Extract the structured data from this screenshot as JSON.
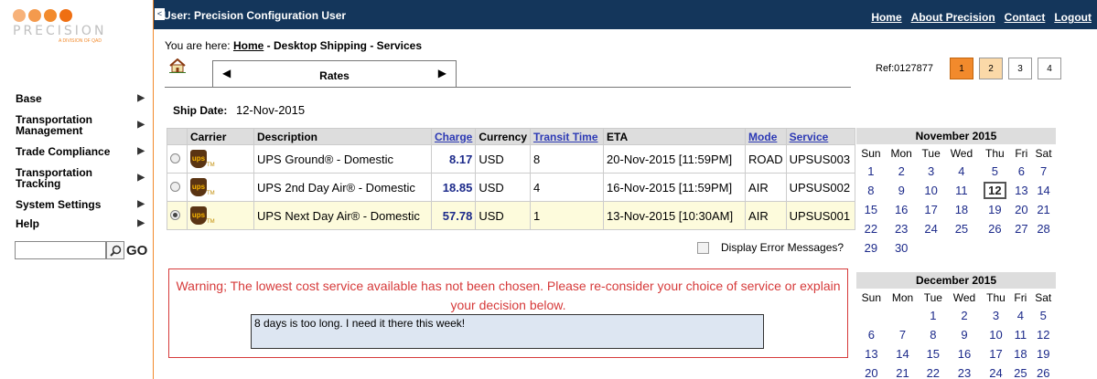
{
  "logo": {
    "name": "PRECISION",
    "tagline": "A DIVISION OF QAD",
    "dot_colors": [
      "#f7b27a",
      "#f49a4d",
      "#f28a2c",
      "#ef6f12"
    ]
  },
  "sidebar": {
    "items": [
      {
        "label": "Base"
      },
      {
        "label": "Transportation Management"
      },
      {
        "label": "Trade Compliance"
      },
      {
        "label": "Transportation Tracking"
      },
      {
        "label": "System Settings"
      },
      {
        "label": "Help"
      }
    ],
    "search_value": "",
    "go_label": "GO"
  },
  "header": {
    "collapse_glyph": "<",
    "user_label": "User: Precision Configuration User",
    "links": [
      "Home",
      "About Precision",
      "Contact",
      "Logout"
    ]
  },
  "breadcrumb": {
    "prefix": "You are here:",
    "home": "Home",
    "current": "- Desktop Shipping - Services"
  },
  "tab": {
    "label": "Rates",
    "left_arrow": "◀",
    "right_arrow": "▶"
  },
  "ref": {
    "label": "Ref:0127877"
  },
  "pages": {
    "items": [
      "1",
      "2",
      "3",
      "4"
    ],
    "active": "1"
  },
  "ship_date": {
    "label": "Ship Date:",
    "value": "12-Nov-2015"
  },
  "rates_table": {
    "headers": [
      "",
      "Carrier",
      "Description",
      "Charge",
      "Currency",
      "Transit Time",
      "ETA",
      "Mode",
      "Service"
    ],
    "rows": [
      {
        "selected": false,
        "carrier": "ups",
        "description": "UPS Ground® - Domestic",
        "charge": "8.17",
        "currency": "USD",
        "transit": "8",
        "eta": "20-Nov-2015 [11:59PM]",
        "mode": "ROAD",
        "service": "UPSUS003"
      },
      {
        "selected": false,
        "carrier": "ups",
        "description": "UPS 2nd Day Air® - Domestic",
        "charge": "18.85",
        "currency": "USD",
        "transit": "4",
        "eta": "16-Nov-2015 [11:59PM]",
        "mode": "AIR",
        "service": "UPSUS002"
      },
      {
        "selected": true,
        "carrier": "ups",
        "description": "UPS Next Day Air® - Domestic",
        "charge": "57.78",
        "currency": "USD",
        "transit": "1",
        "eta": "13-Nov-2015 [10:30AM]",
        "mode": "AIR",
        "service": "UPSUS001"
      }
    ]
  },
  "error_messages": {
    "label": "Display Error Messages?",
    "checked": false
  },
  "warning": {
    "text": "Warning; The lowest cost service available has not been chosen. Please re-consider your choice of service or explain your decision below.",
    "reason_value": "8 days is too long. I need it there this week!"
  },
  "calendars": [
    {
      "title": "November 2015",
      "days": [
        "Sun",
        "Mon",
        "Tue",
        "Wed",
        "Thu",
        "Fri",
        "Sat"
      ],
      "weeks": [
        [
          "1",
          "2",
          "3",
          "4",
          "5",
          "6",
          "7"
        ],
        [
          "8",
          "9",
          "10",
          "11",
          "12",
          "13",
          "14"
        ],
        [
          "15",
          "16",
          "17",
          "18",
          "19",
          "20",
          "21"
        ],
        [
          "22",
          "23",
          "24",
          "25",
          "26",
          "27",
          "28"
        ],
        [
          "29",
          "30",
          "",
          "",
          "",
          "",
          ""
        ]
      ],
      "today": "12"
    },
    {
      "title": "December 2015",
      "days": [
        "Sun",
        "Mon",
        "Tue",
        "Wed",
        "Thu",
        "Fri",
        "Sat"
      ],
      "weeks": [
        [
          "",
          "",
          "1",
          "2",
          "3",
          "4",
          "5"
        ],
        [
          "6",
          "7",
          "8",
          "9",
          "10",
          "11",
          "12"
        ],
        [
          "13",
          "14",
          "15",
          "16",
          "17",
          "18",
          "19"
        ],
        [
          "20",
          "21",
          "22",
          "23",
          "24",
          "25",
          "26"
        ]
      ],
      "today": ""
    }
  ]
}
